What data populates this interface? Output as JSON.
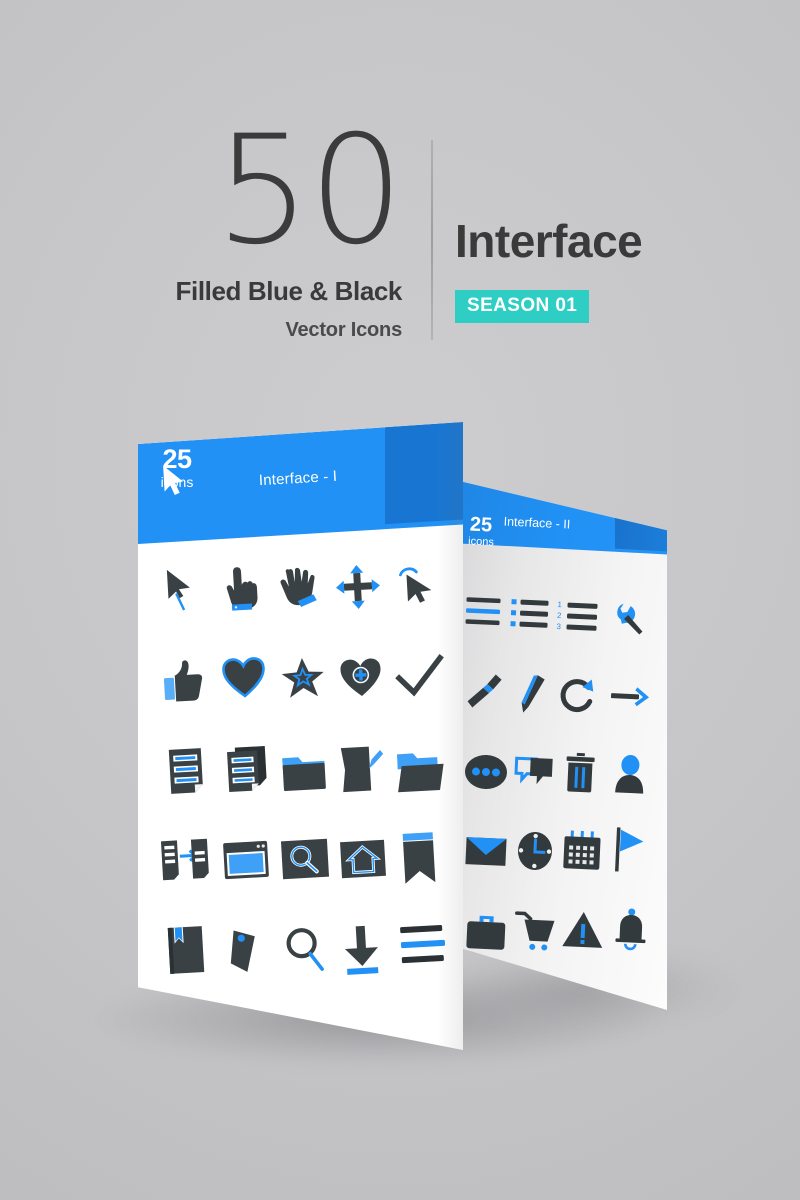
{
  "header": {
    "count": "50",
    "subtitle_1": "Filled Blue & Black",
    "subtitle_2": "Vector Icons",
    "title": "Interface",
    "season_badge": "SEASON 01"
  },
  "colors": {
    "blue": "#2191f5",
    "blue_dark": "#1876d2",
    "teal": "#2ecec4",
    "charcoal": "#3a3a3a",
    "background": "#c6c6c8",
    "panel_white": "#ffffff"
  },
  "panels": [
    {
      "id": "interface-i",
      "title": "Interface - I",
      "count": "25",
      "count_label": "icons",
      "header_icon": "cursor-arrow-icon",
      "icons": [
        "cursor-arrow-icon",
        "pointing-hand-icon",
        "grab-hand-icon",
        "move-arrows-icon",
        "select-cursor-icon",
        "thumbs-up-icon",
        "heart-icon",
        "star-icon",
        "heart-plus-icon",
        "checkmark-icon",
        "document-icon",
        "copy-documents-icon",
        "folder-icon",
        "edit-document-icon",
        "open-folder-icon",
        "export-file-icon",
        "browser-window-icon",
        "search-box-icon",
        "home-button-icon",
        "bookmark-ribbon-icon",
        "bookmarked-book-icon",
        "price-tag-icon",
        "magnifier-icon",
        "download-arrow-icon",
        "menu-lines-icon"
      ]
    },
    {
      "id": "interface-ii",
      "title": "Interface - II",
      "count": "25",
      "count_label": "icons",
      "icons": [
        "text-lines-icon",
        "bullet-list-icon",
        "numbered-list-icon",
        "wrench-icon",
        "paint-brush-icon",
        "pencil-icon",
        "refresh-arrow-icon",
        "right-arrow-icon",
        "more-options-icon",
        "chat-bubbles-icon",
        "trash-bin-icon",
        "user-profile-icon",
        "envelope-icon",
        "clock-icon",
        "calendar-icon",
        "flag-icon",
        "briefcase-icon",
        "shopping-cart-icon",
        "warning-triangle-icon",
        "notification-bell-icon"
      ]
    }
  ]
}
